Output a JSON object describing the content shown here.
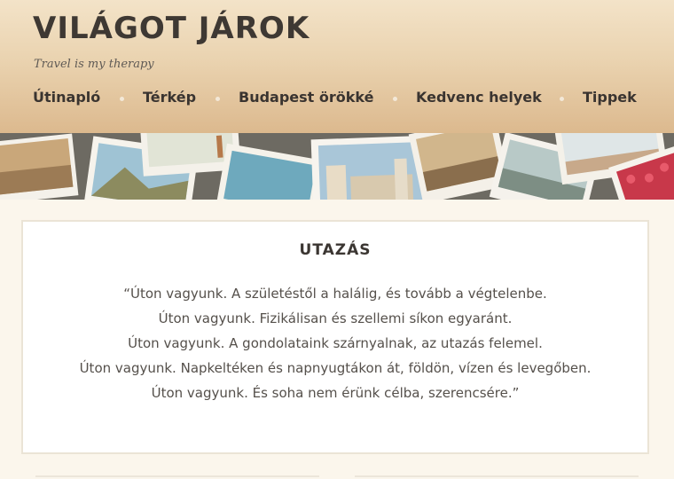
{
  "site": {
    "title": "VILÁGOT JÁROK",
    "tagline": "Travel is my therapy"
  },
  "nav": {
    "items": [
      {
        "label": "Útinapló"
      },
      {
        "label": "Térkép"
      },
      {
        "label": "Budapest örökké"
      },
      {
        "label": "Kedvenc helyek"
      },
      {
        "label": "Tippek"
      }
    ]
  },
  "post": {
    "title": "UTAZÁS",
    "lines": [
      "“Úton vagyunk. A születéstől a halálig, és tovább a végtelenbe.",
      "Úton vagyunk. Fizikálisan és szellemi síkon egyaránt.",
      "Úton vagyunk. A gondolataink szárnyalnak, az utazás felemel.",
      "Úton vagyunk. Napkeltéken és napnyugtákon át, földön, vízen és levegőben.",
      "Úton vagyunk. És soha nem érünk célba, szerencsére.”"
    ]
  },
  "colors": {
    "header_top": "#f3e3c8",
    "header_bottom": "#dcb98e",
    "text_dark": "#3e3833",
    "page_background": "#fbf6ec"
  }
}
